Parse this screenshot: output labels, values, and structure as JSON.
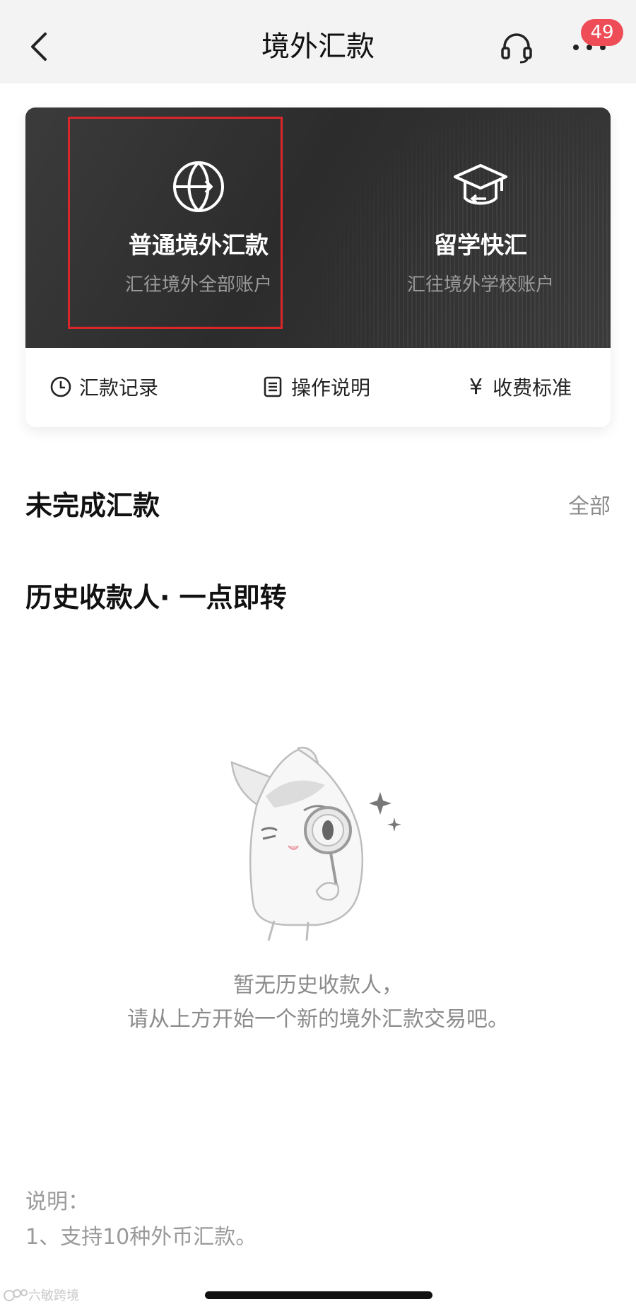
{
  "header": {
    "title": "境外汇款",
    "badge_count": "49",
    "icons": {
      "back": "chevron-left-icon",
      "service": "headset-icon",
      "more": "more-dots-icon"
    }
  },
  "remit_options": [
    {
      "title": "普通境外汇款",
      "subtitle": "汇往境外全部账户",
      "icon": "globe-icon",
      "highlighted": true
    },
    {
      "title": "留学快汇",
      "subtitle": "汇往境外学校账户",
      "icon": "graduation-cap-icon",
      "highlighted": false
    }
  ],
  "quick_links": [
    {
      "label": "汇款记录",
      "icon": "clock-icon"
    },
    {
      "label": "操作说明",
      "icon": "document-icon"
    },
    {
      "label": "收费标准",
      "icon": "yen-icon",
      "glyph": "¥"
    }
  ],
  "pending": {
    "title": "未完成汇款",
    "see_all": "全部"
  },
  "payees": {
    "title": "历史收款人· 一点即转",
    "empty_line1": "暂无历史收款人，",
    "empty_line2": "请从上方开始一个新的境外汇款交易吧。"
  },
  "notes": {
    "label": "说明：",
    "items": [
      "1、支持10种外币汇款。"
    ]
  },
  "watermark": "六敏跨境",
  "colors": {
    "badge": "#ee4d57",
    "highlight_border": "#d8262b",
    "card_dark": "#2f2f2f",
    "muted_text": "#8b8b8b"
  }
}
